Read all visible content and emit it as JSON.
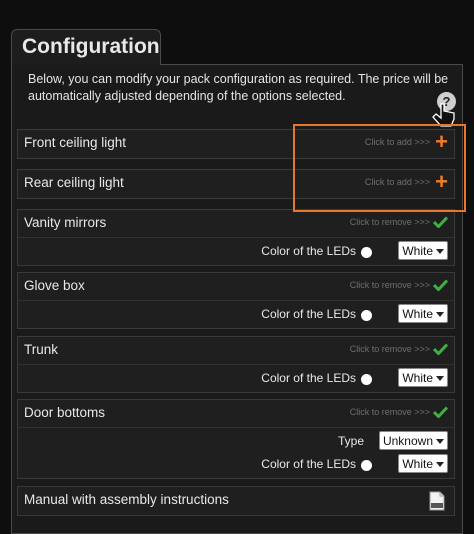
{
  "tab_title": "Configuration",
  "intro_text": "Below, you can modify your pack configuration as required. The price will be automatically adjusted depending of the options selected.",
  "help_label": "?",
  "items": [
    {
      "title": "Front ceiling light",
      "action": "Click to add >>>"
    },
    {
      "title": "Rear ceiling light",
      "action": "Click to add >>>"
    },
    {
      "title": "Vanity mirrors",
      "action": "Click to remove >>>",
      "leds_label": "Color of the LEDs",
      "leds_value": "White"
    },
    {
      "title": "Glove box",
      "action": "Click to remove >>>",
      "leds_label": "Color of the LEDs",
      "leds_value": "White"
    },
    {
      "title": "Trunk",
      "action": "Click to remove >>>",
      "leds_label": "Color of the LEDs",
      "leds_value": "White"
    },
    {
      "title": "Door bottoms",
      "action": "Click to remove >>>",
      "type_label": "Type",
      "type_value": "Unknown",
      "leds_label": "Color of the LEDs",
      "leds_value": "White"
    },
    {
      "title": "Manual with assembly instructions",
      "icon": "pdf-icon"
    }
  ],
  "colors": {
    "accent_orange": "#f07d28",
    "check_green": "#3fb03f",
    "highlight": "#e9742c"
  }
}
